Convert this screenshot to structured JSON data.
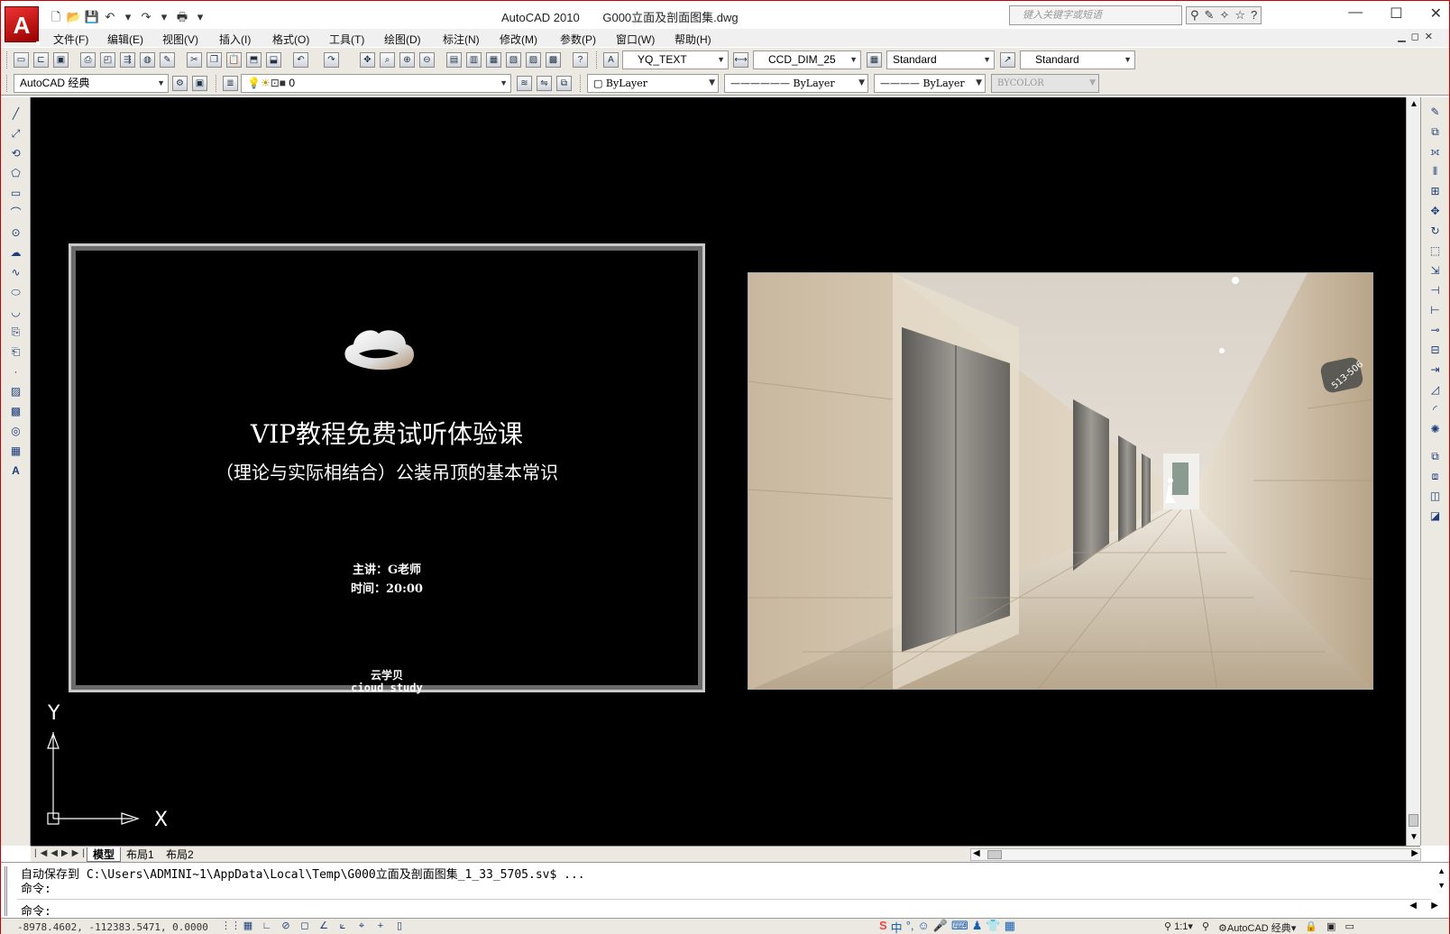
{
  "window": {
    "app_name": "AutoCAD 2010",
    "file_name": "G000立面及剖面图集.dwg",
    "search_placeholder": "键入关键字或短语"
  },
  "menu": [
    "文件(F)",
    "编辑(E)",
    "视图(V)",
    "插入(I)",
    "格式(O)",
    "工具(T)",
    "绘图(D)",
    "标注(N)",
    "修改(M)",
    "参数(P)",
    "窗口(W)",
    "帮助(H)"
  ],
  "styles_toolbar": {
    "text_style": "YQ_TEXT",
    "dim_style": "CCD_DIM_25",
    "table_style": "Standard",
    "mleader_style": "Standard"
  },
  "workspace_toolbar": {
    "workspace": "AutoCAD 经典",
    "layer": "0",
    "color": "ByLayer",
    "linetype": "ByLayer",
    "lineweight": "ByLayer",
    "plotstyle": "BYCOLOR"
  },
  "slide": {
    "title": "VIP教程免费试听体验课",
    "subtitle": "（理论与实际相结合）公装吊顶的基本常识",
    "lecturer": "主讲：G老师",
    "time": "时间：20:00",
    "brand_cn": "云学贝",
    "brand_en": "cioud study"
  },
  "photo": {
    "sign_text": "513-506"
  },
  "ucs": {
    "x_label": "X",
    "y_label": "Y"
  },
  "tabs": [
    "模型",
    "布局1",
    "布局2"
  ],
  "command": {
    "history": "自动保存到 C:\\Users\\ADMINI~1\\AppData\\Local\\Temp\\G000立面及剖面图集_1_33_5705.sv$ ...",
    "prev_prompt": "命令:",
    "prompt": "命令:"
  },
  "status": {
    "coordinates": "-8978.4602, -112383.5471, 0.0000",
    "ime_mode": "中",
    "annotation_scale": "1:1",
    "workspace": "AutoCAD 经典"
  },
  "colors": {
    "canvas": "#000000",
    "toolbar": "#ece9e2",
    "accent": "#cc0000"
  }
}
